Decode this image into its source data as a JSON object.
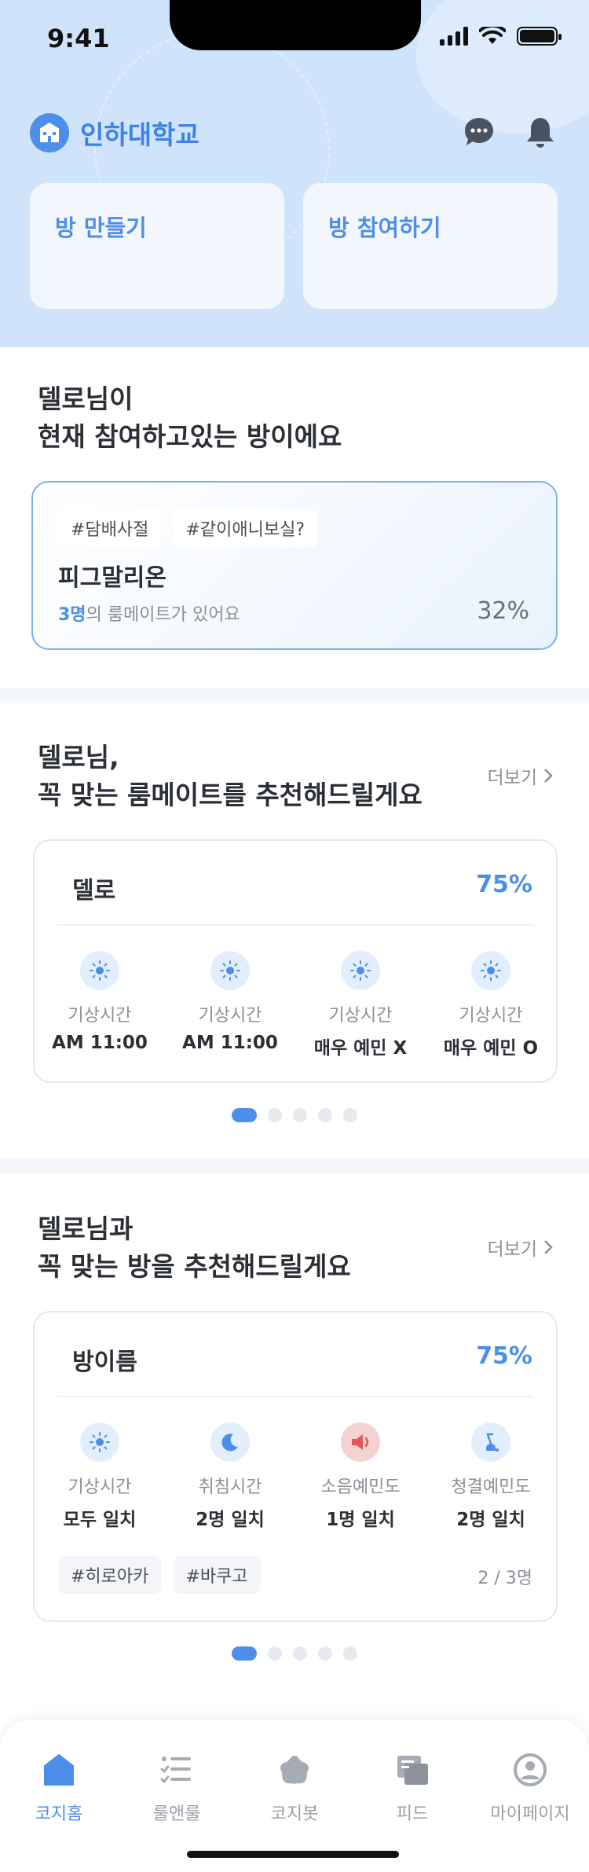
{
  "status": {
    "time": "9:41"
  },
  "header": {
    "school_name": "인하대학교",
    "create_label": "방 만들기",
    "join_label": "방 참여하기"
  },
  "current_room": {
    "title_line1": "델로님이",
    "title_line2": "현재 참여하고있는 방이에요",
    "tags": [
      "#담배사절",
      "#같이애니보실?"
    ],
    "room_name": "피그말리온",
    "mates_count": "3명",
    "mates_suffix": "의 룸메이트가 있어요",
    "percent": "32%"
  },
  "roommate_rec": {
    "title_line1": "델로님,",
    "title_line2": "꼭 맞는 룸메이트를 추천해드릴게요",
    "more_label": "더보기",
    "card": {
      "name": "델로",
      "percent": "75%",
      "stats": [
        {
          "icon": "sun-icon",
          "label": "기상시간",
          "value": "AM 11:00"
        },
        {
          "icon": "sun-icon",
          "label": "기상시간",
          "value": "AM 11:00"
        },
        {
          "icon": "sun-icon",
          "label": "기상시간",
          "value": "매우 예민 X"
        },
        {
          "icon": "sun-icon",
          "label": "기상시간",
          "value": "매우 예민 O"
        }
      ]
    },
    "page_index": 1,
    "page_count": 5
  },
  "room_rec": {
    "title_line1": "델로님과",
    "title_line2": "꼭 맞는 방을 추천해드릴게요",
    "more_label": "더보기",
    "card": {
      "name": "방이름",
      "percent": "75%",
      "stats": [
        {
          "icon": "sun-icon",
          "label": "기상시간",
          "value": "모두 일치"
        },
        {
          "icon": "moon-icon",
          "label": "취침시간",
          "value": "2명 일치"
        },
        {
          "icon": "speaker-icon",
          "label": "소음예민도",
          "value": "1명 일치"
        },
        {
          "icon": "vacuum-icon",
          "label": "청결예민도",
          "value": "2명 일치"
        }
      ],
      "tags": [
        "#히로아카",
        "#바쿠고"
      ],
      "count": "2 / 3명"
    },
    "page_index": 1,
    "page_count": 5
  },
  "bottom_nav": {
    "items": [
      {
        "label": "코지홈",
        "icon": "home-icon",
        "active": true
      },
      {
        "label": "룰앤룰",
        "icon": "checklist-icon",
        "active": false
      },
      {
        "label": "코지봇",
        "icon": "bot-icon",
        "active": false
      },
      {
        "label": "피드",
        "icon": "feed-icon",
        "active": false
      },
      {
        "label": "마이페이지",
        "icon": "profile-icon",
        "active": false
      }
    ]
  },
  "colors": {
    "accent": "#4c8fea",
    "header_bg": "#cfe3fb"
  }
}
